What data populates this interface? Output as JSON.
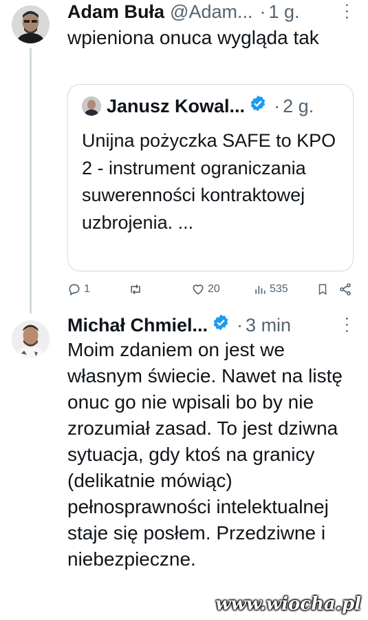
{
  "tweet1": {
    "name": "Adam Buła",
    "handle": "@Adam...",
    "time": "1 g.",
    "text": "wpieniona onuca wygląda tak"
  },
  "quote": {
    "name": "Janusz Kowal...",
    "time": "2 g.",
    "text": "Unijna pożyczka SAFE to KPO 2 - instrument ograniczania suwerenności kontraktowej uzbrojenia. ..."
  },
  "actions": {
    "replies": "1",
    "likes": "20",
    "views": "535"
  },
  "tweet2": {
    "name": "Michał Chmiel...",
    "time": "3 min",
    "text": "Moim zdaniem on jest we własnym świecie. Nawet na listę onuc go nie wpisali bo by nie zrozumiał zasad. To jest dziwna sytuacja, gdy ktoś na granicy (delikatnie mówiąc) pełnosprawności intelektualnej staje się posłem. Przedziwne i niebezpieczne."
  },
  "watermark": "www.wiocha.pl",
  "icons": {
    "verified": "verified-badge-icon",
    "reply": "reply-icon",
    "retweet": "retweet-icon",
    "like": "heart-icon",
    "views": "views-icon",
    "bookmark": "bookmark-icon",
    "share": "share-icon",
    "more": "more-icon"
  },
  "colors": {
    "verified": "#1d9bf0",
    "secondary_text": "#536471",
    "border": "#cfd9de"
  }
}
